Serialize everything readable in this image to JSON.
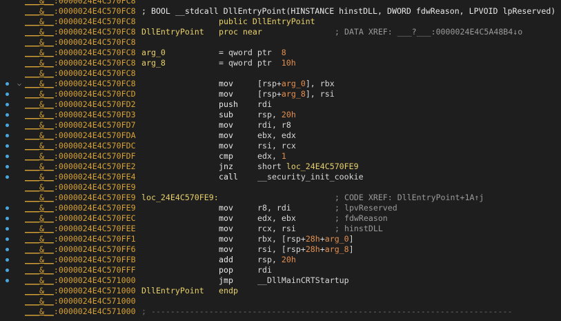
{
  "accent": "#d7a236",
  "flow_color": "#4aa8e0",
  "segment_prefix": "___&__",
  "lines": [
    {
      "addr": "0000024E4C570FC8"
    },
    {
      "addr": "0000024E4C570FC8",
      "proto": "; BOOL __stdcall DllEntryPoint(HINSTANCE hinstDLL, DWORD fdwReason, LPVOID lpReserved)"
    },
    {
      "addr": "0000024E4C570FC8",
      "directive": "public DllEntryPoint"
    },
    {
      "addr": "0000024E4C570FC8",
      "label": "DllEntryPoint",
      "directive": "proc near",
      "comment": "; DATA XREF: ___?___:0000024E4C5A48B4↓o"
    },
    {
      "addr": "0000024E4C570FC8"
    },
    {
      "addr": "0000024E4C570FC8",
      "label": "arg_0",
      "directive": "= qword ptr  8"
    },
    {
      "addr": "0000024E4C570FC8",
      "label": "arg_8",
      "directive": "= qword ptr  10h"
    },
    {
      "addr": "0000024E4C570FC8"
    },
    {
      "addr": "0000024E4C570FC8",
      "mnem": "mov",
      "operands": "[rsp+arg_0], rbx"
    },
    {
      "addr": "0000024E4C570FCD",
      "mnem": "mov",
      "operands": "[rsp+arg_8], rsi"
    },
    {
      "addr": "0000024E4C570FD2",
      "mnem": "push",
      "operands": "rdi"
    },
    {
      "addr": "0000024E4C570FD3",
      "mnem": "sub",
      "operands": "rsp, 20h"
    },
    {
      "addr": "0000024E4C570FD7",
      "mnem": "mov",
      "operands": "rdi, r8"
    },
    {
      "addr": "0000024E4C570FDA",
      "mnem": "mov",
      "operands": "ebx, edx"
    },
    {
      "addr": "0000024E4C570FDC",
      "mnem": "mov",
      "operands": "rsi, rcx"
    },
    {
      "addr": "0000024E4C570FDF",
      "mnem": "cmp",
      "operands": "edx, 1"
    },
    {
      "addr": "0000024E4C570FE2",
      "mnem": "jnz",
      "operands": "short loc_24E4C570FE9"
    },
    {
      "addr": "0000024E4C570FE4",
      "mnem": "call",
      "operands": "__security_init_cookie"
    },
    {
      "addr": "0000024E4C570FE9"
    },
    {
      "addr": "0000024E4C570FE9",
      "label": "loc_24E4C570FE9:",
      "comment": "; CODE XREF: DllEntryPoint+1A↑j"
    },
    {
      "addr": "0000024E4C570FE9",
      "mnem": "mov",
      "operands": "r8, rdi",
      "comment": "; lpvReserved"
    },
    {
      "addr": "0000024E4C570FEC",
      "mnem": "mov",
      "operands": "edx, ebx",
      "comment": "; fdwReason"
    },
    {
      "addr": "0000024E4C570FEE",
      "mnem": "mov",
      "operands": "rcx, rsi",
      "comment": "; hinstDLL"
    },
    {
      "addr": "0000024E4C570FF1",
      "mnem": "mov",
      "operands": "rbx, [rsp+28h+arg_0]"
    },
    {
      "addr": "0000024E4C570FF6",
      "mnem": "mov",
      "operands": "rsi, [rsp+28h+arg_8]"
    },
    {
      "addr": "0000024E4C570FFB",
      "mnem": "add",
      "operands": "rsp, 20h"
    },
    {
      "addr": "0000024E4C570FFF",
      "mnem": "pop",
      "operands": "rdi"
    },
    {
      "addr": "0000024E4C571000",
      "mnem": "jmp",
      "operands": "__DllMainCRTStartup"
    },
    {
      "addr": "0000024E4C571000",
      "label": "DllEntryPoint",
      "directive": "endp"
    },
    {
      "addr": "0000024E4C571000"
    },
    {
      "addr": "0000024E4C571000",
      "separator": "; ---------------------------------------------------------------------------"
    }
  ]
}
